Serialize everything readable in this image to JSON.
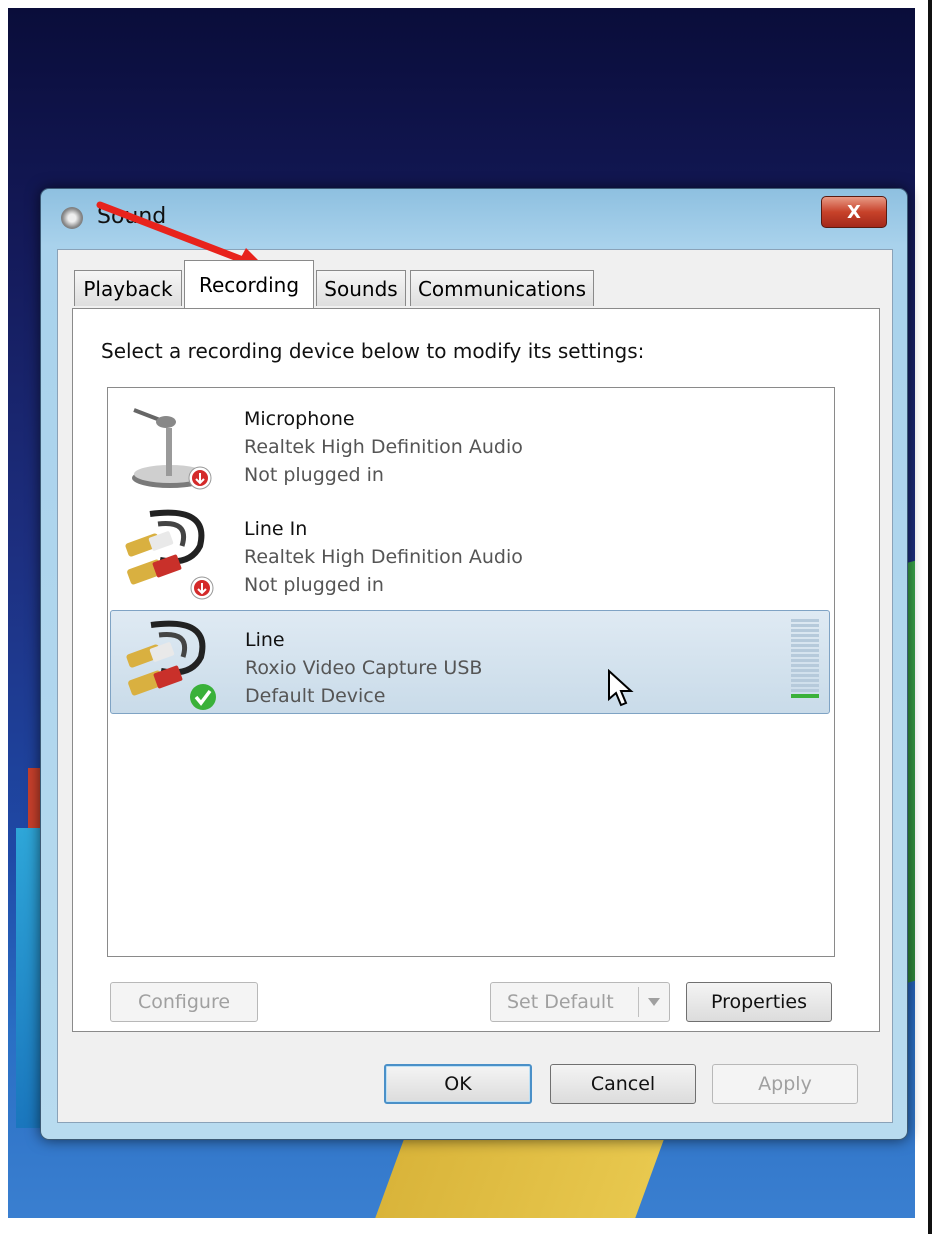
{
  "window": {
    "title": "Sound",
    "close_label": "X"
  },
  "tabs": [
    {
      "label": "Playback"
    },
    {
      "label": "Recording"
    },
    {
      "label": "Sounds"
    },
    {
      "label": "Communications"
    }
  ],
  "active_tab": "Recording",
  "instruction": "Select a recording device below to modify its settings:",
  "devices": [
    {
      "name": "Microphone",
      "description": "Realtek High Definition Audio",
      "status": "Not plugged in",
      "icon": "microphone-icon",
      "badge": "unplugged-badge-icon"
    },
    {
      "name": "Line In",
      "description": "Realtek High Definition Audio",
      "status": "Not plugged in",
      "icon": "rca-cable-icon",
      "badge": "unplugged-badge-icon"
    },
    {
      "name": "Line",
      "description": "Roxio Video Capture USB",
      "status": "Default Device",
      "icon": "rca-cable-icon",
      "badge": "default-check-icon",
      "selected": true,
      "level_fraction": 0.06
    }
  ],
  "buttons": {
    "configure": "Configure",
    "set_default": "Set Default",
    "properties": "Properties",
    "ok": "OK",
    "cancel": "Cancel",
    "apply": "Apply"
  },
  "colors": {
    "annotation_arrow": "#e8231c",
    "selection": "#c9dbe9",
    "default_check": "#3ab13a",
    "unplugged_badge": "#d42a2a"
  }
}
